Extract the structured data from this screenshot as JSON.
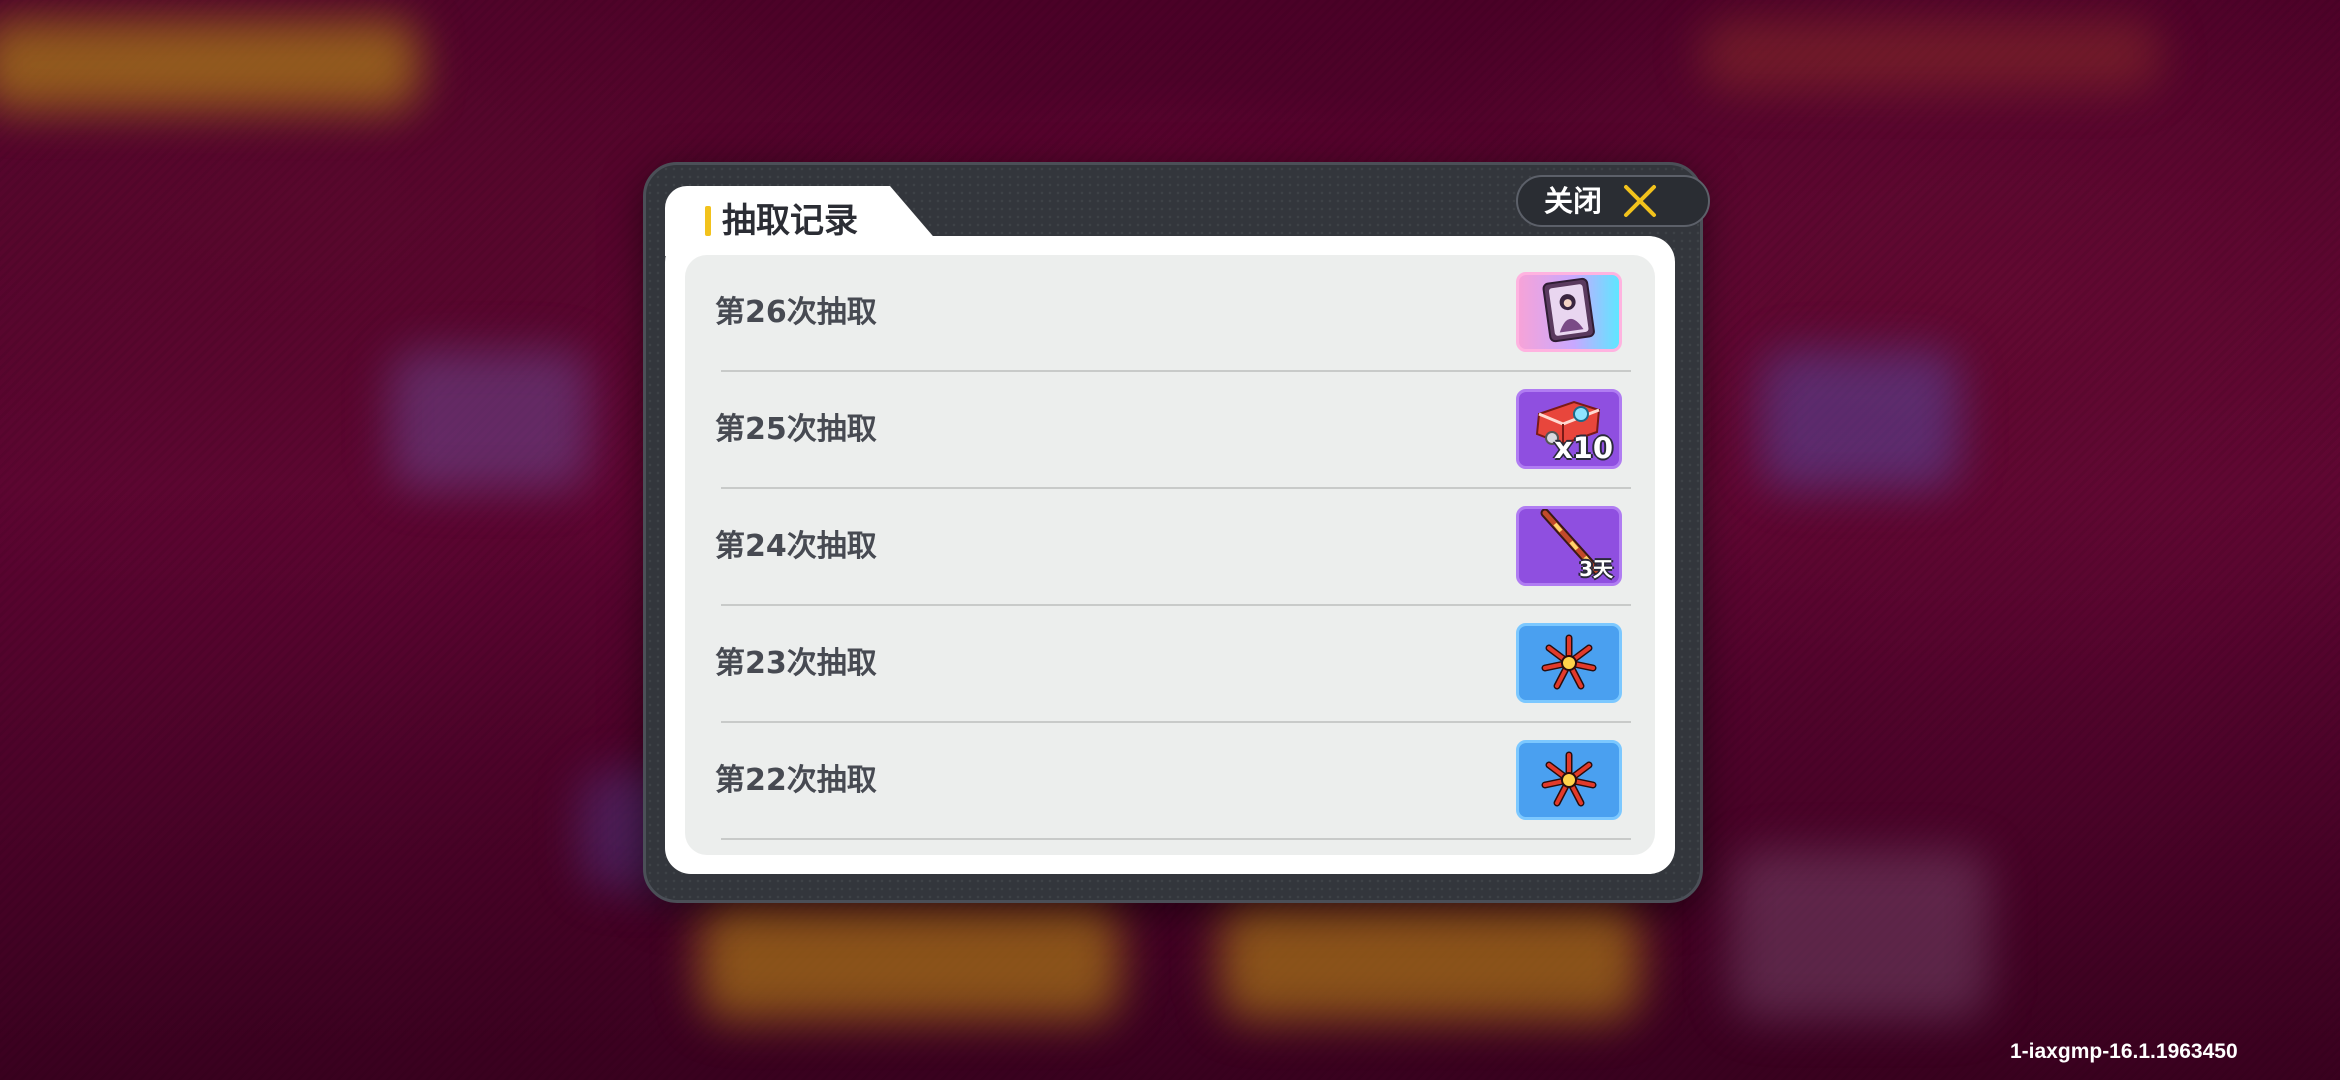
{
  "dialog": {
    "title": "抽取记录",
    "close_label": "关闭",
    "close_icon": "close-x-icon",
    "accent_color": "#f2c21c"
  },
  "records": [
    {
      "label": "第26次抽取",
      "item_icon": "character-card-icon",
      "frame": "pink-gradient",
      "quantity": ""
    },
    {
      "label": "第25次抽取",
      "item_icon": "red-gift-pack-icon",
      "frame": "purple",
      "quantity": "x10"
    },
    {
      "label": "第24次抽取",
      "item_icon": "spear-weapon-icon",
      "frame": "purple",
      "quantity": "3天"
    },
    {
      "label": "第23次抽取",
      "item_icon": "firework-icon",
      "frame": "blue",
      "quantity": ""
    },
    {
      "label": "第22次抽取",
      "item_icon": "firework-icon",
      "frame": "blue",
      "quantity": ""
    }
  ],
  "version": "1-iaxgmp-16.1.1963450"
}
